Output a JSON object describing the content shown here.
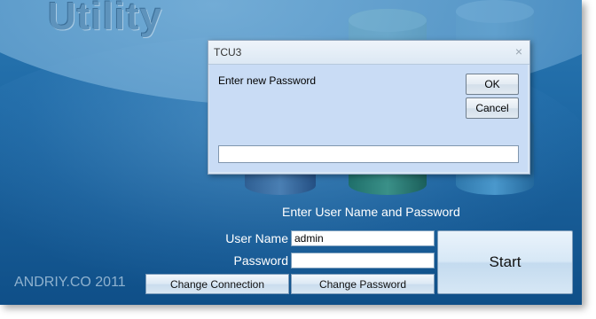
{
  "app": {
    "title": "Utility",
    "prompt": "Enter User Name and Password",
    "copyright": "ANDRIY.CO 2011"
  },
  "login": {
    "username_label": "User Name",
    "username_value": "admin",
    "password_label": "Password",
    "password_value": "",
    "start_label": "Start",
    "change_connection_label": "Change Connection",
    "change_password_label": "Change Password"
  },
  "dialog": {
    "title": "TCU3",
    "close_glyph": "×",
    "prompt": "Enter new Password",
    "ok_label": "OK",
    "cancel_label": "Cancel",
    "input_value": ""
  }
}
